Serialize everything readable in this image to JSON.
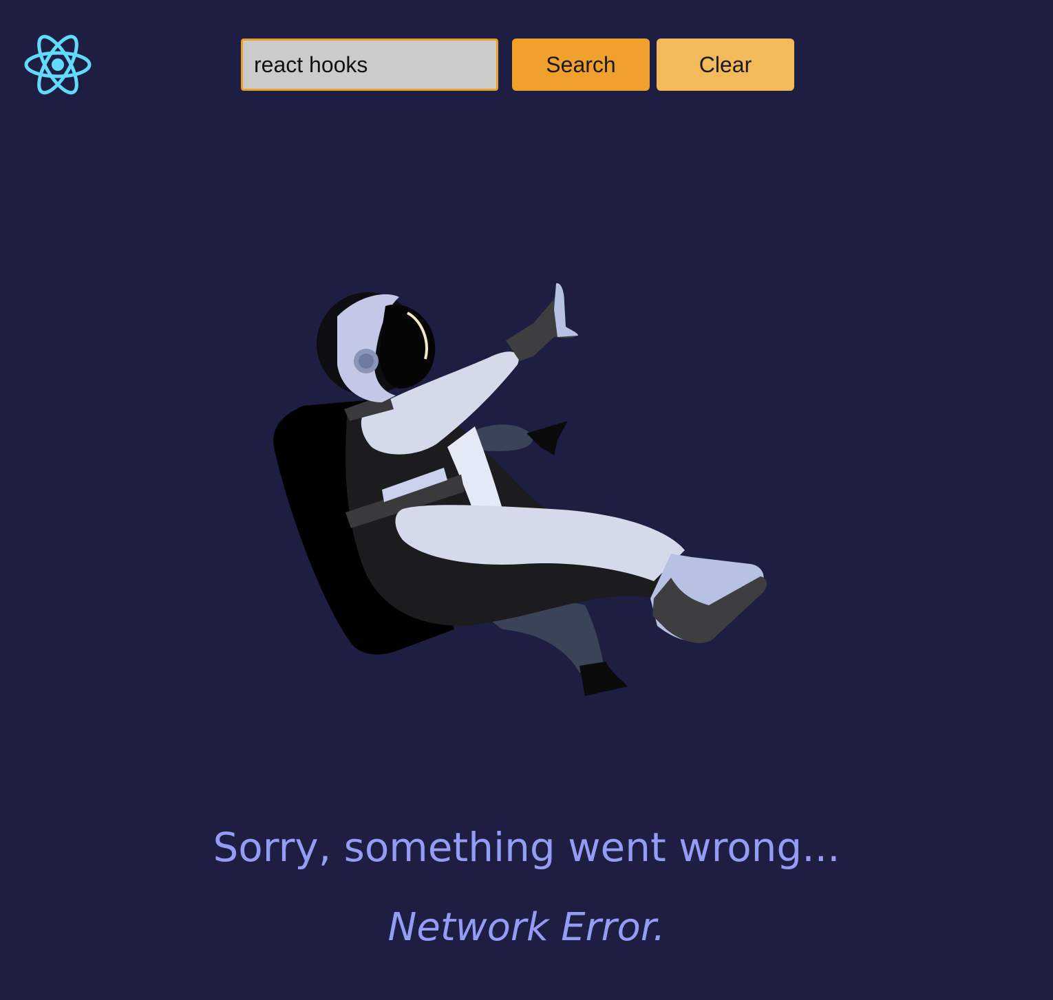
{
  "header": {
    "logo_icon": "react-atom-icon",
    "logo_color": "#61dafb",
    "search": {
      "value": "react hooks",
      "placeholder": ""
    },
    "search_label": "Search",
    "clear_label": "Clear"
  },
  "illustration": {
    "icon": "astronaut-floating-illustration"
  },
  "error": {
    "message": "Sorry, something went wrong...",
    "detail": "Network Error."
  },
  "colors": {
    "background": "#1e1d42",
    "accent": "#f0a02d",
    "accent_light": "#f3ba5c",
    "error_text": "#959cf5"
  }
}
